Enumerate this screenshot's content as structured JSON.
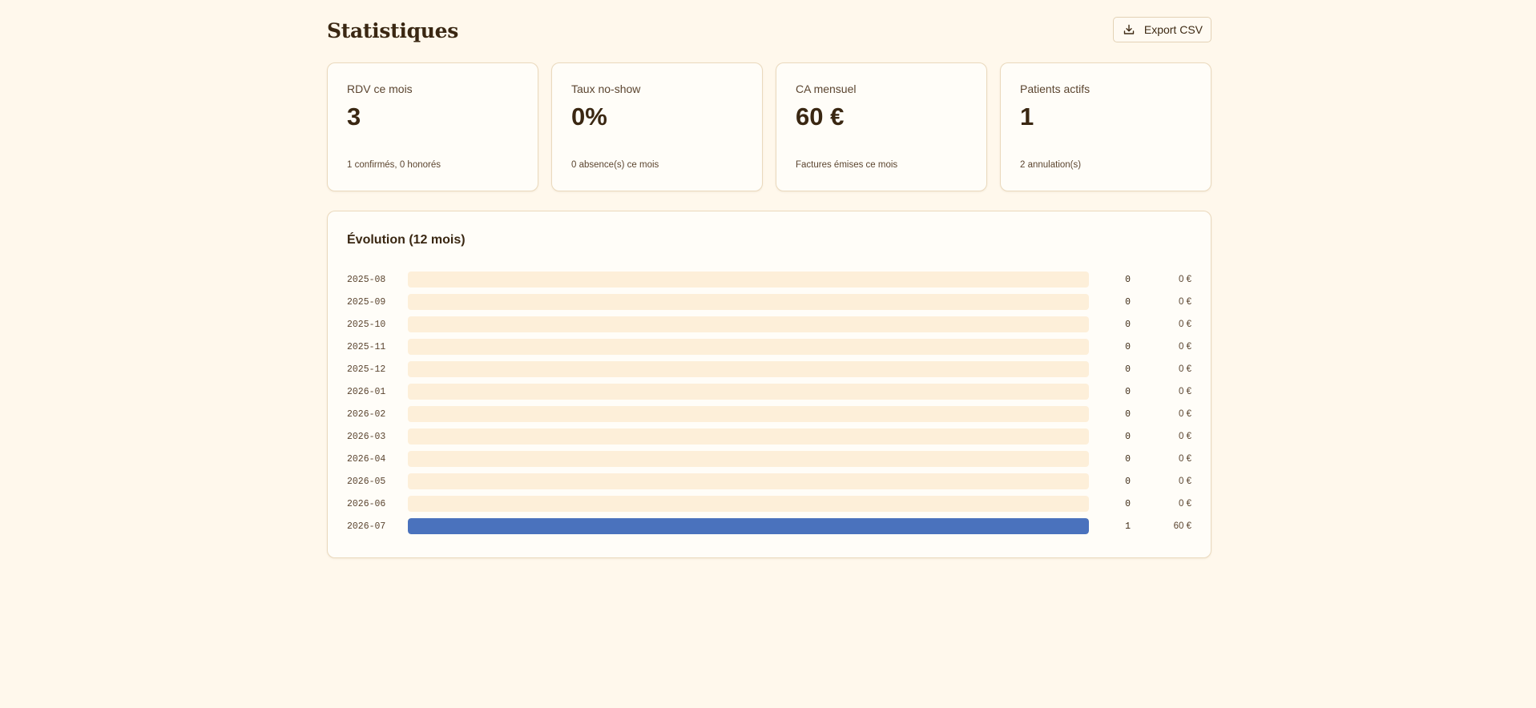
{
  "header": {
    "title": "Statistiques",
    "export_label": "Export CSV",
    "export_icon": "download-icon"
  },
  "kpis": [
    {
      "label": "RDV ce mois",
      "value": "3",
      "sub": "1 confirmés, 0 honorés"
    },
    {
      "label": "Taux no-show",
      "value": "0%",
      "sub": "0 absence(s) ce mois"
    },
    {
      "label": "CA mensuel",
      "value": "60 €",
      "sub": "Factures émises ce mois"
    },
    {
      "label": "Patients actifs",
      "value": "1",
      "sub": "2 annulation(s)"
    }
  ],
  "evolution": {
    "title": "Évolution (12 mois)",
    "rows": [
      {
        "month": "2025-08",
        "count": "0",
        "amount": "0 €",
        "fill": 0
      },
      {
        "month": "2025-09",
        "count": "0",
        "amount": "0 €",
        "fill": 0
      },
      {
        "month": "2025-10",
        "count": "0",
        "amount": "0 €",
        "fill": 0
      },
      {
        "month": "2025-11",
        "count": "0",
        "amount": "0 €",
        "fill": 0
      },
      {
        "month": "2025-12",
        "count": "0",
        "amount": "0 €",
        "fill": 0
      },
      {
        "month": "2026-01",
        "count": "0",
        "amount": "0 €",
        "fill": 0
      },
      {
        "month": "2026-02",
        "count": "0",
        "amount": "0 €",
        "fill": 0
      },
      {
        "month": "2026-03",
        "count": "0",
        "amount": "0 €",
        "fill": 0
      },
      {
        "month": "2026-04",
        "count": "0",
        "amount": "0 €",
        "fill": 0
      },
      {
        "month": "2026-05",
        "count": "0",
        "amount": "0 €",
        "fill": 0
      },
      {
        "month": "2026-06",
        "count": "0",
        "amount": "0 €",
        "fill": 0
      },
      {
        "month": "2026-07",
        "count": "1",
        "amount": "60 €",
        "fill": 1
      }
    ]
  },
  "colors": {
    "background": "#fff8ec",
    "card": "#fffdf8",
    "card_border": "#ead9bd",
    "bar_track": "#fdefd9",
    "bar_fill": "#4a72bd",
    "text": "#3a2712"
  }
}
